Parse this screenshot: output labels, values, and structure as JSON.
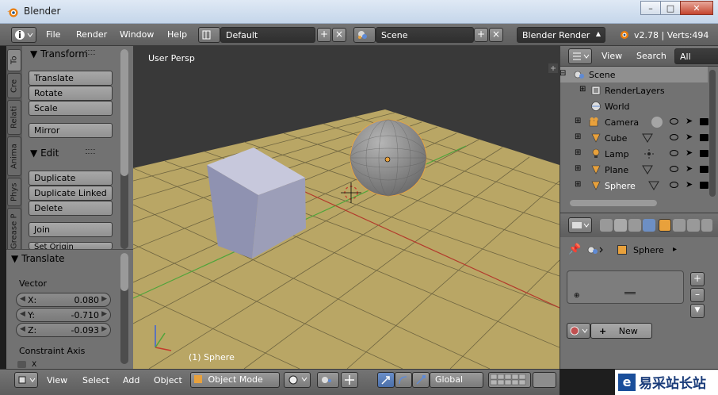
{
  "window": {
    "title": "Blender"
  },
  "info_header": {
    "menus": [
      "File",
      "Render",
      "Window",
      "Help"
    ],
    "screen_layout": "Default",
    "scene": "Scene",
    "render_engine": "Blender Render",
    "version_stats": "v2.78 | Verts:494"
  },
  "tool_tabs": [
    "To",
    "Cre",
    "Relati",
    "Anima",
    "Phys",
    "Grease P"
  ],
  "tool_shelf": {
    "transform_header": "Transform",
    "transform_buttons": [
      "Translate",
      "Rotate",
      "Scale"
    ],
    "mirror_button": "Mirror",
    "edit_header": "Edit",
    "edit_buttons": [
      "Duplicate",
      "Duplicate Linked",
      "Delete"
    ],
    "join_button": "Join",
    "set_origin_button": "Set Origin"
  },
  "operator_panel": {
    "header": "Translate",
    "vector_label": "Vector",
    "x_label": "X:",
    "x_value": "0.080",
    "y_label": "Y:",
    "y_value": "-0.710",
    "z_label": "Z:",
    "z_value": "-0.093",
    "constraint_label": "Constraint Axis",
    "constraint_x": "X"
  },
  "viewport": {
    "view_name": "User Persp",
    "object_label": "(1) Sphere"
  },
  "view3d_header": {
    "menus": [
      "View",
      "Select",
      "Add",
      "Object"
    ],
    "mode": "Object Mode",
    "orientation": "Global"
  },
  "outliner": {
    "view_menu": "View",
    "search_menu": "Search",
    "filter": "All Scen",
    "items": [
      {
        "label": "Scene"
      },
      {
        "label": "RenderLayers"
      },
      {
        "label": "World"
      },
      {
        "label": "Camera"
      },
      {
        "label": "Cube"
      },
      {
        "label": "Lamp"
      },
      {
        "label": "Plane"
      },
      {
        "label": "Sphere"
      }
    ]
  },
  "properties": {
    "breadcrumb_object": "Sphere",
    "new_button": "New"
  },
  "watermark": {
    "text": "易采站长站"
  },
  "colors": {
    "floor": "#b9a665",
    "cube": "#9c9eb8",
    "sphere": "#8e8e8e",
    "origin_dot": "#e8a13c",
    "x_axis": "#b33a2c",
    "y_axis": "#4fa43a",
    "selected_row": "#8f8f8f"
  }
}
